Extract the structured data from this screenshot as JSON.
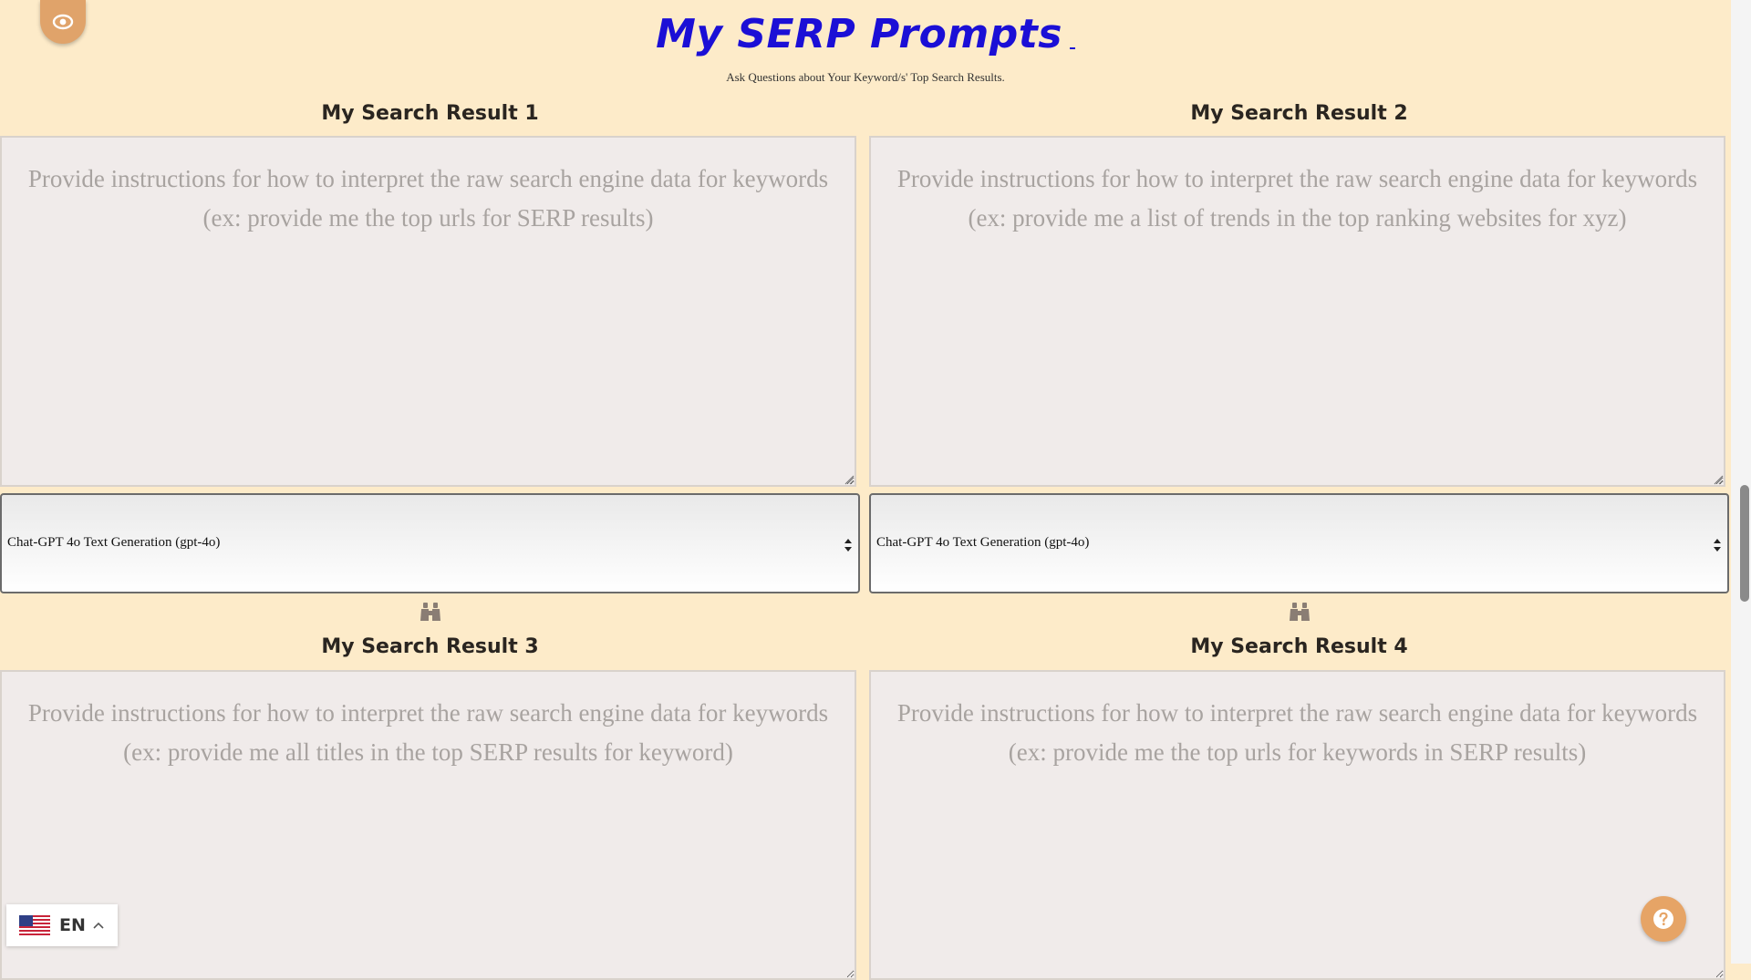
{
  "header": {
    "title": "My SERP Prompts",
    "subtitle": "Ask Questions about Your Keyword/s' Top Search Results."
  },
  "results": [
    {
      "title": "My Search Result 1",
      "placeholder": "Provide instructions for how to interpret the raw search engine data for keywords (ex: provide me the top urls for SERP results)",
      "model": "Chat-GPT 4o Text Generation (gpt-4o)"
    },
    {
      "title": "My Search Result 2",
      "placeholder": "Provide instructions for how to interpret the raw search engine data for keywords (ex: provide me a list of trends in the top ranking websites for xyz)",
      "model": "Chat-GPT 4o Text Generation (gpt-4o)"
    },
    {
      "title": "My Search Result 3",
      "placeholder": "Provide instructions for how to interpret the raw search engine data for keywords (ex: provide me all titles in the top SERP results for keyword)"
    },
    {
      "title": "My Search Result 4",
      "placeholder": "Provide instructions for how to interpret the raw search engine data for keywords (ex: provide me the top urls for keywords in SERP results)"
    }
  ],
  "language": {
    "code": "EN"
  },
  "icons": {
    "toggle": "eye-icon",
    "search": "binoculars-icon",
    "help": "question-icon",
    "flag": "us-flag-icon",
    "chevron": "chevron-up-icon"
  },
  "colors": {
    "background": "#fdebc9",
    "title": "#1b0fd6",
    "accent": "#e6a466",
    "textarea": "#f0ebea"
  }
}
